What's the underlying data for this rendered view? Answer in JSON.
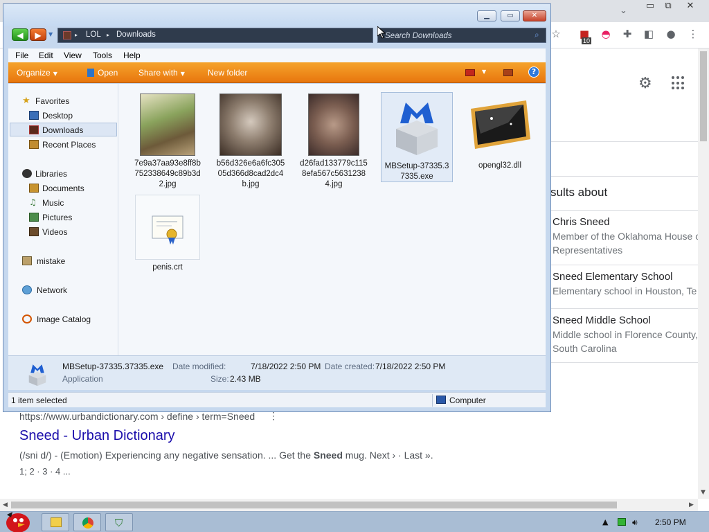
{
  "explorer": {
    "address_crumbs": [
      "LOL",
      "Downloads"
    ],
    "search_placeholder": "Search Downloads",
    "menu": [
      "File",
      "Edit",
      "View",
      "Tools",
      "Help"
    ],
    "commands": {
      "organize": "Organize",
      "open": "Open",
      "share_with": "Share with",
      "new_folder": "New folder"
    },
    "nav": {
      "favorites": "Favorites",
      "desktop": "Desktop",
      "downloads": "Downloads",
      "recent_places": "Recent Places",
      "libraries": "Libraries",
      "documents": "Documents",
      "music": "Music",
      "pictures": "Pictures",
      "videos": "Videos",
      "mistake": "mistake",
      "network": "Network",
      "image_catalog": "Image Catalog"
    },
    "files": [
      {
        "name": "7e9a37aa93e8ff8b752338649c89b3d2.jpg",
        "icon": "image-thumbnail-icon"
      },
      {
        "name": "b56d326e6a6fc30505d366d8cad2dc4b.jpg",
        "icon": "image-thumbnail-icon"
      },
      {
        "name": "d26fad133779c1158efa567c56312384.jpg",
        "icon": "image-thumbnail-icon"
      },
      {
        "name": "MBSetup-37335.37335.exe",
        "icon": "malwarebytes-installer-icon"
      },
      {
        "name": "opengl32.dll",
        "icon": "dll-file-icon"
      },
      {
        "name": "penis.crt",
        "icon": "certificate-icon"
      }
    ],
    "details": {
      "file_name": "MBSetup-37335.37335.exe",
      "file_type": "Application",
      "modified_label": "Date modified:",
      "modified_value": "7/18/2022 2:50 PM",
      "created_label": "Date created:",
      "created_value": "7/18/2022 2:50 PM",
      "size_label": "Size:",
      "size_value": "2.43 MB"
    },
    "status": {
      "selection": "1 item selected",
      "location": "Computer"
    }
  },
  "browser": {
    "results_about": "sults about",
    "knowledge_items": [
      {
        "title": "Chris Sneed",
        "subtitle": "Member of the Oklahoma House of Representatives"
      },
      {
        "title": "Sneed Elementary School",
        "subtitle": "Elementary school in Houston, Te"
      },
      {
        "title": "Sneed Middle School",
        "subtitle": "Middle school in Florence County, South Carolina"
      }
    ],
    "result": {
      "url": "https://www.urbandictionary.com › define › term=Sneed",
      "title": "Sneed - Urban Dictionary",
      "snippet_pre": "(/sni d/) - (Emotion) Experiencing any negative sensation. ... Get the ",
      "snippet_bold": "Sneed",
      "snippet_post": " mug. Next › · Last ».",
      "pages": "1; 2 · 3 · 4 ..."
    },
    "extension_badge": "10"
  },
  "taskbar": {
    "clock": "2:50 PM"
  },
  "colors": {
    "command_bar": "#e8760d",
    "link_blue": "#1a0dab",
    "address_bar": "#2f3b4c"
  }
}
